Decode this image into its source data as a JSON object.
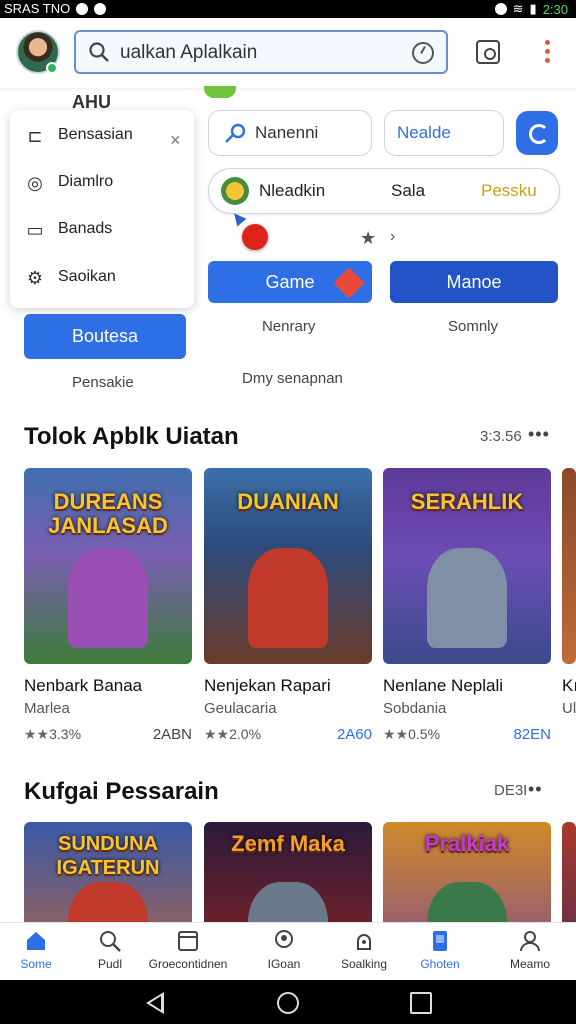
{
  "status_bar": {
    "carrier": "SRAS TNO",
    "time": "2:30"
  },
  "search": {
    "value": "ualkan Aplalkain",
    "placeholder": ""
  },
  "ghost_label": "AHU",
  "menu": {
    "items": [
      {
        "label": "Bensasian",
        "icon": "folder-icon"
      },
      {
        "label": "Diamlro",
        "icon": "compass-icon"
      },
      {
        "label": "Banads",
        "icon": "bookmark-icon"
      },
      {
        "label": "Saoikan",
        "icon": "settings-icon"
      }
    ],
    "close": "×"
  },
  "left_button": {
    "label": "Boutesa",
    "caption": "Pensakie"
  },
  "chips": {
    "first": "Nanenni",
    "second": "Nealde"
  },
  "tag_row": {
    "first": "Nleadkin",
    "second": "Sala",
    "third": "Pessku"
  },
  "buttons": {
    "game": "Game",
    "manoe": "Manoe",
    "game_caption": "Nenrary",
    "manoe_caption": "Somnly",
    "center_caption": "Dmy senapnan"
  },
  "marks": {
    "star": "★",
    "chevron": "›"
  },
  "section1": {
    "title": "Tolok Apblk Uiatan",
    "meta": "3:3.56",
    "cards": [
      {
        "art_title": "DUREANS JANLASAD",
        "name": "Nenbark Banaa",
        "sub": "Marlea",
        "rating": "3.3%",
        "stars": "★★",
        "count": "2ABN"
      },
      {
        "art_title": "DUANIAN",
        "name": "Nenjekan Rapari",
        "sub": "Geulacaria",
        "rating": "2.0%",
        "stars": "★★",
        "count": "2A60"
      },
      {
        "art_title": "SERAHLIK",
        "name": "Nenlane Neplali",
        "sub": "Sobdania",
        "rating": "0.5%",
        "stars": "★★",
        "count": "82EN"
      },
      {
        "art_title": "",
        "name": "Kı",
        "sub": "Ul",
        "rating": "",
        "stars": "",
        "count": ""
      }
    ]
  },
  "section2": {
    "title": "Kufgai Pessarain",
    "meta": "DE3I",
    "cards": [
      {
        "art_title": "SUNDUNA IGATERUN"
      },
      {
        "art_title": "Zemf Maka"
      },
      {
        "art_title": "Pralkiak"
      },
      {
        "art_title": ""
      }
    ]
  },
  "bottom_nav": [
    {
      "label": "Some",
      "icon": "home-icon"
    },
    {
      "label": "Pudl",
      "icon": "search-icon"
    },
    {
      "label": "Groecontidnen",
      "icon": "library-icon"
    },
    {
      "label": "IGoan",
      "icon": "profile-icon"
    },
    {
      "label": "Soalking",
      "icon": "game-icon"
    },
    {
      "label": "Ghoten",
      "icon": "apps-icon"
    },
    {
      "label": "Meamo",
      "icon": "person-icon"
    }
  ],
  "colors": {
    "accent": "#2f6fe6",
    "dark_accent": "#2254c8",
    "gold": "#c8a21a"
  }
}
